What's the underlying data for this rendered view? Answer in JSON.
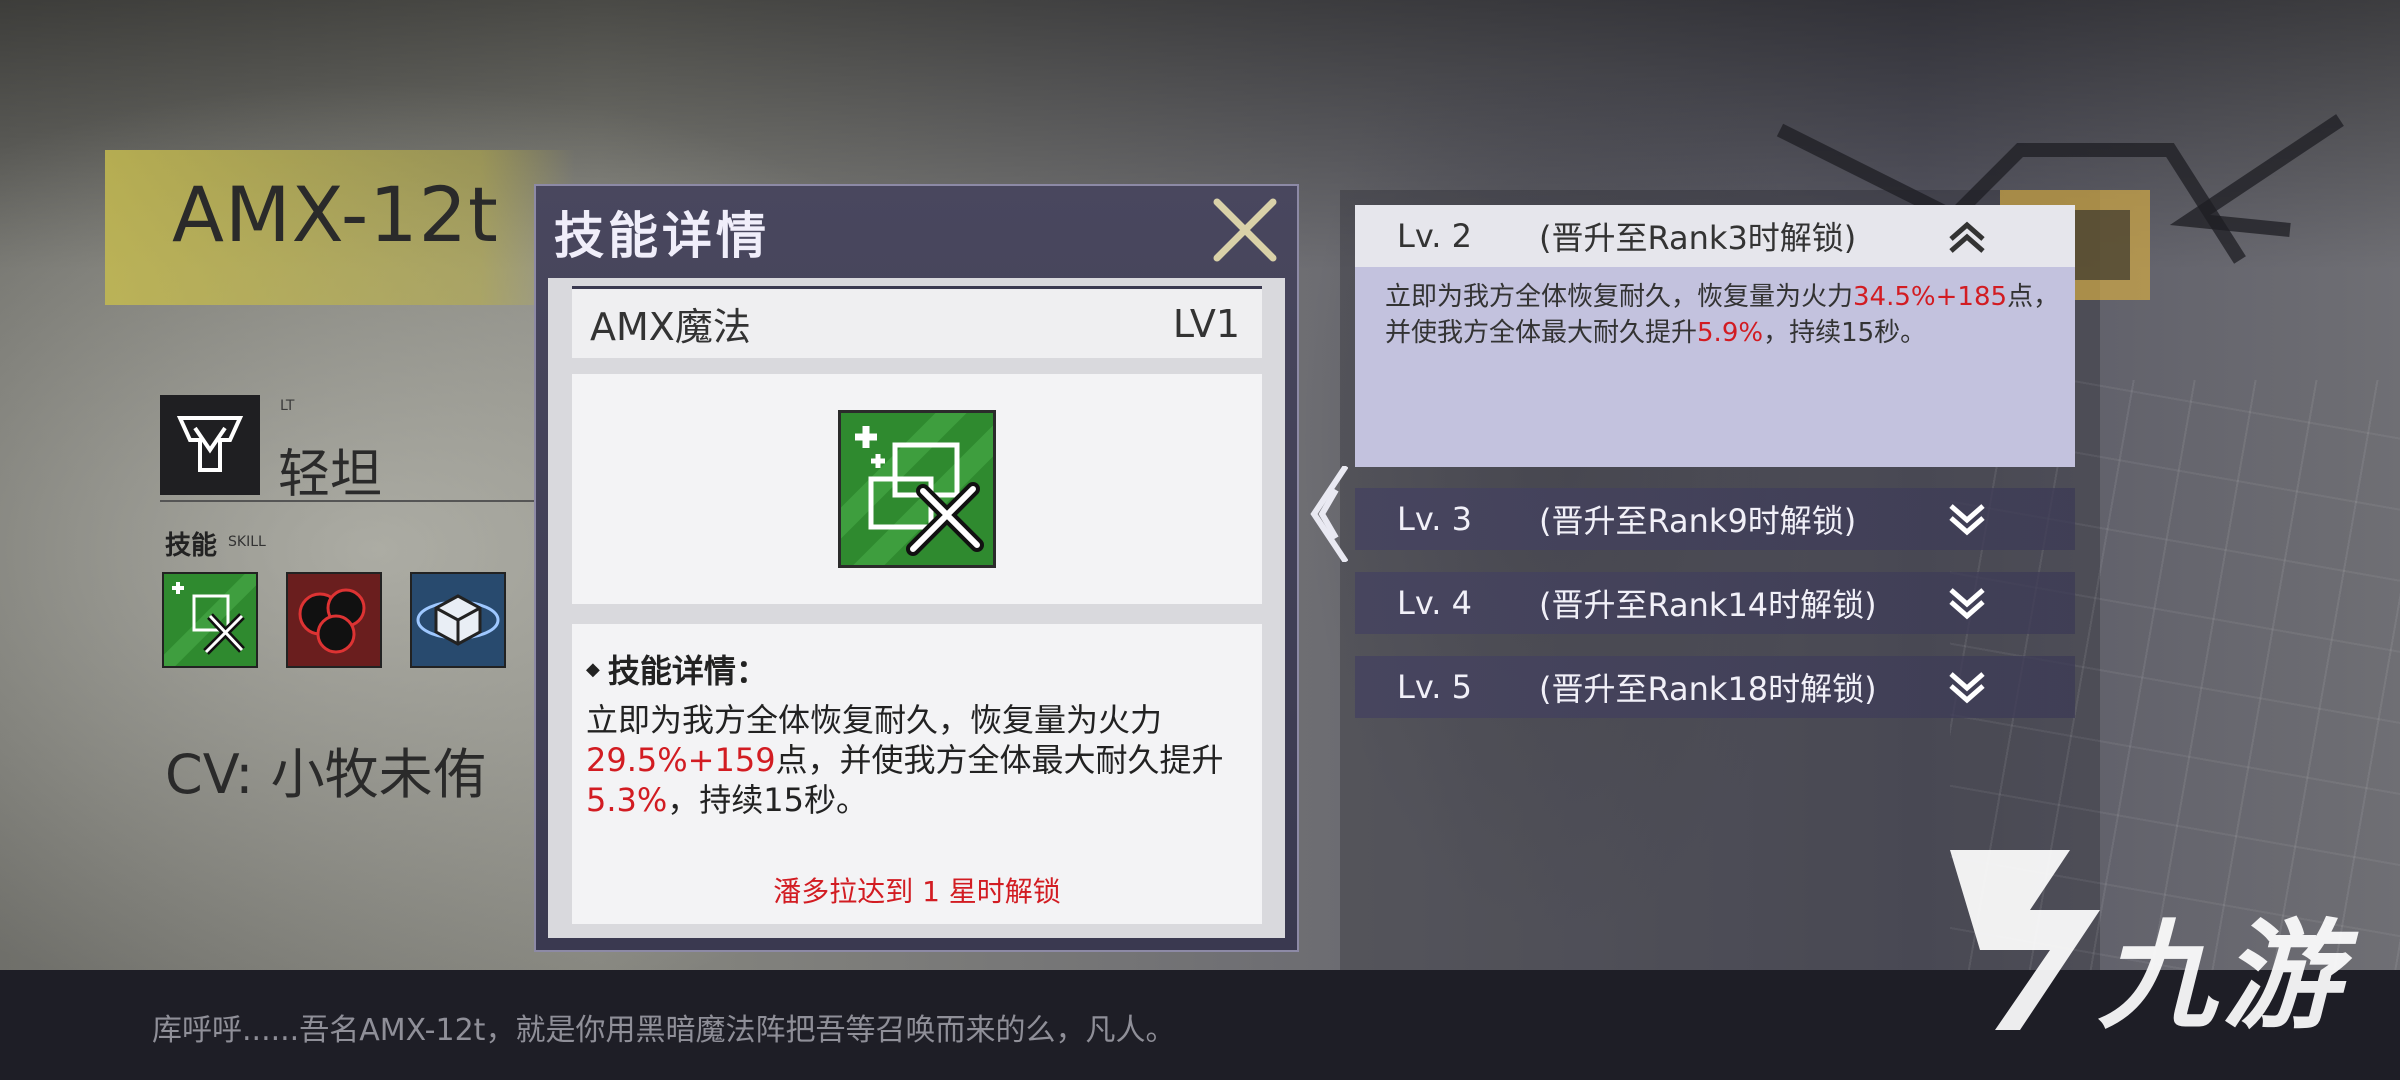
{
  "character": {
    "name": "AMX-12t",
    "class_code": "LT",
    "class_name": "轻坦",
    "skill_label": "技能",
    "skill_sub_label": "SKILL",
    "cv": "CV: 小牧未侑"
  },
  "dialog": {
    "title": "技能详情",
    "skill_name": "AMX魔法",
    "skill_level": "LV1",
    "detail_heading": "技能详情：",
    "detail_text": {
      "p1": "立即为我方全体恢复耐久，恢复量为火力",
      "v1": "29.5%",
      "p2": "+",
      "v2": "159",
      "p3": "点，并使我方全体最大耐久提升",
      "v3": "5.3%",
      "p4": "，持续15秒。"
    },
    "unlock_note": "潘多拉达到 1 星时解锁"
  },
  "levels": [
    {
      "lv": "Lv. 2",
      "unlock": "(晋升至Rank3时解锁)",
      "expanded": true,
      "desc": {
        "p1": "立即为我方全体恢复耐久，恢复量为火力",
        "v1": "34.5%",
        "p2": "+",
        "v2": "185",
        "p3": "点，并使我方全体最大耐久提升",
        "v3": "5.9%",
        "p4": "，持续15秒。"
      }
    },
    {
      "lv": "Lv. 3",
      "unlock": "(晋升至Rank9时解锁)",
      "expanded": false
    },
    {
      "lv": "Lv. 4",
      "unlock": "(晋升至Rank14时解锁)",
      "expanded": false
    },
    {
      "lv": "Lv. 5",
      "unlock": "(晋升至Rank18时解锁)",
      "expanded": false
    }
  ],
  "dialogue_line": "库呼呼......吾名AMX-12t，就是你用黑暗魔法阵把吾等召唤而来的么，凡人。",
  "watermark": "九游",
  "colors": {
    "accent_red": "#d21c22",
    "dialog_bg": "#49475e",
    "active_body": "#c3c2de"
  }
}
